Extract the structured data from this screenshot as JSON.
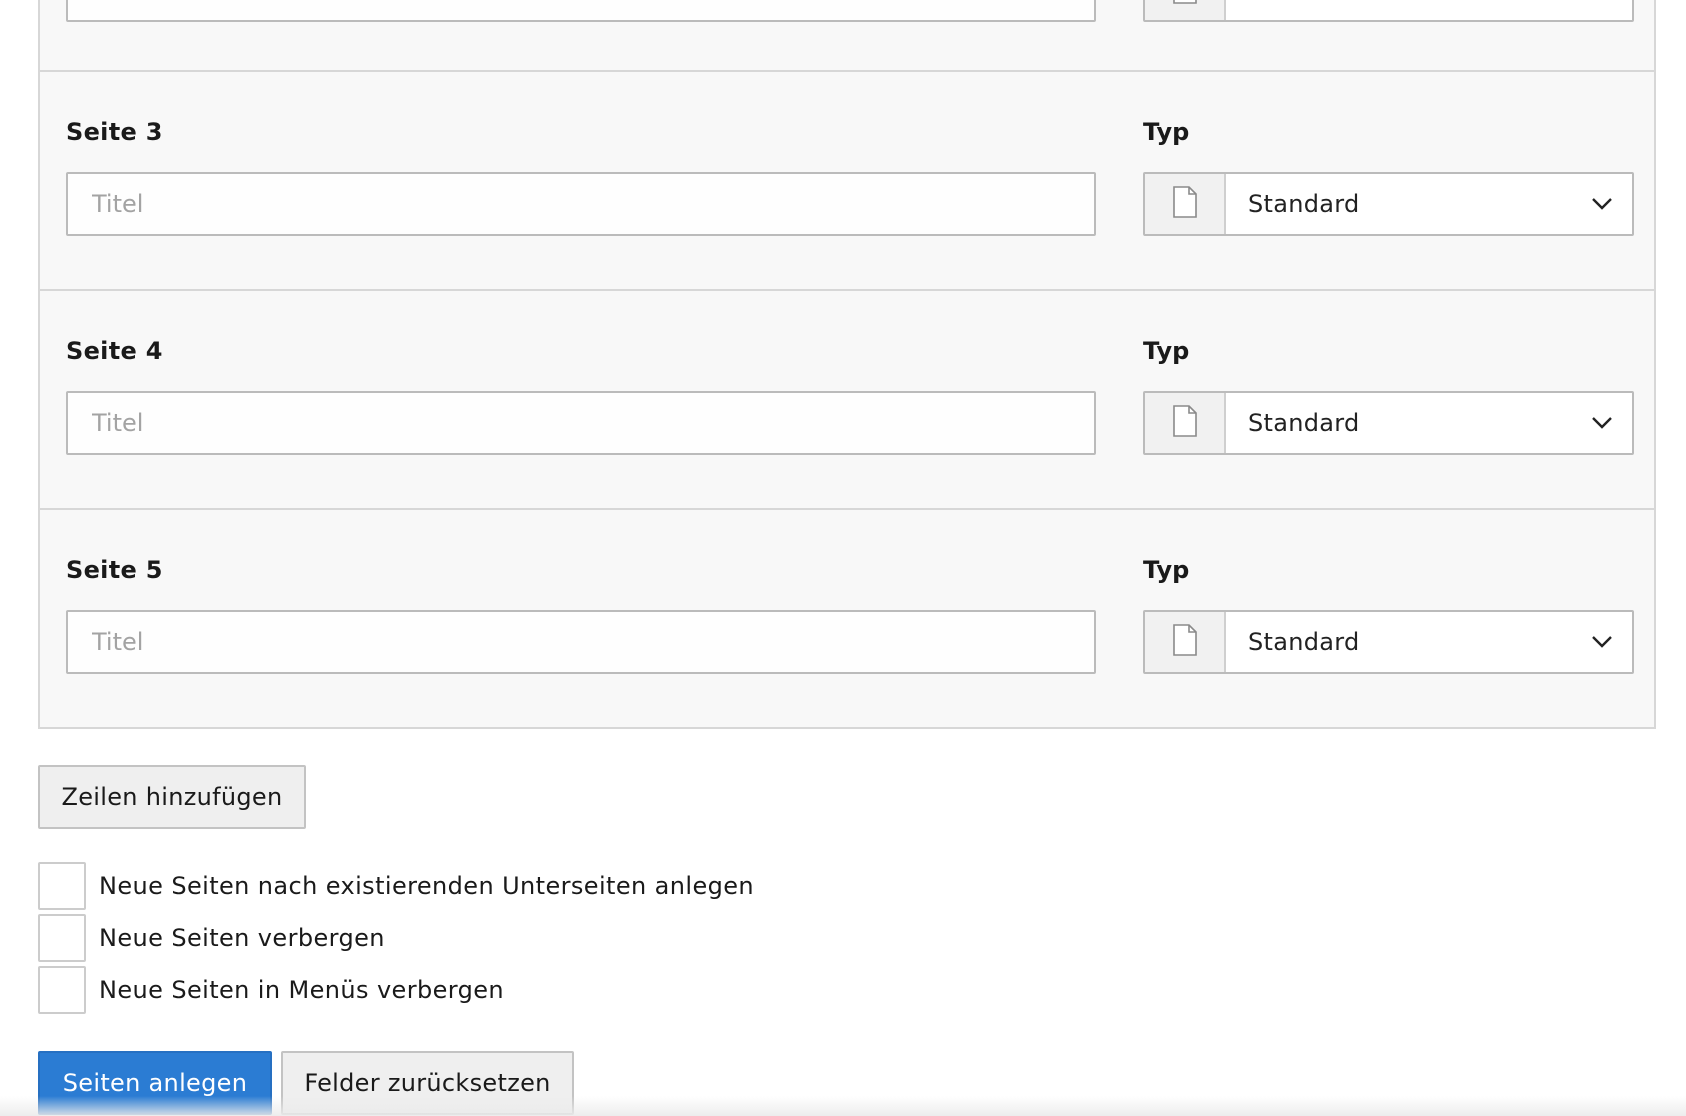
{
  "rows": [
    {
      "label": "",
      "typ_label": "",
      "placeholder": "",
      "type_value": ""
    },
    {
      "label": "Seite 3",
      "typ_label": "Typ",
      "placeholder": "Titel",
      "type_value": "Standard"
    },
    {
      "label": "Seite 4",
      "typ_label": "Typ",
      "placeholder": "Titel",
      "type_value": "Standard"
    },
    {
      "label": "Seite 5",
      "typ_label": "Typ",
      "placeholder": "Titel",
      "type_value": "Standard"
    }
  ],
  "actions": {
    "add_rows_label": "Zeilen hinzufügen",
    "submit_label": "Seiten anlegen",
    "reset_label": "Felder zurücksetzen"
  },
  "options": [
    {
      "label": "Neue Seiten nach existierenden Unterseiten anlegen"
    },
    {
      "label": "Neue Seiten verbergen"
    },
    {
      "label": "Neue Seiten in Menüs verbergen"
    }
  ],
  "colors": {
    "primary": "#2b7cd3",
    "panel_bg": "#f8f8f8",
    "border": "#d7d7d7"
  },
  "icons": {
    "page_type": "document-page-icon",
    "dropdown": "chevron-down-icon"
  }
}
